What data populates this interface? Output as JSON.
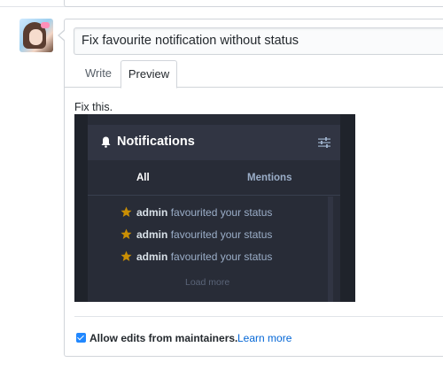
{
  "pr": {
    "title_value": "Fix favourite notification without status",
    "tabs": {
      "write": "Write",
      "preview": "Preview"
    },
    "body_text": "Fix this."
  },
  "screenshot": {
    "header_title": "Notifications",
    "tabs": {
      "all": "All",
      "mentions": "Mentions"
    },
    "notifications": [
      {
        "user": "admin",
        "action": "favourited your status"
      },
      {
        "user": "admin",
        "action": "favourited your status"
      },
      {
        "user": "admin",
        "action": "favourited your status"
      }
    ],
    "load_more": "Load more",
    "icons": {
      "header": "bell-icon",
      "settings": "sliders-icon",
      "notification": "star-icon"
    },
    "colors": {
      "star": "#ca8f04",
      "background": "#282c37",
      "accent_text": "#9baec8"
    }
  },
  "footer": {
    "checkbox_checked": true,
    "checkbox_label": "Allow edits from maintainers.",
    "learn_more": "Learn more"
  }
}
